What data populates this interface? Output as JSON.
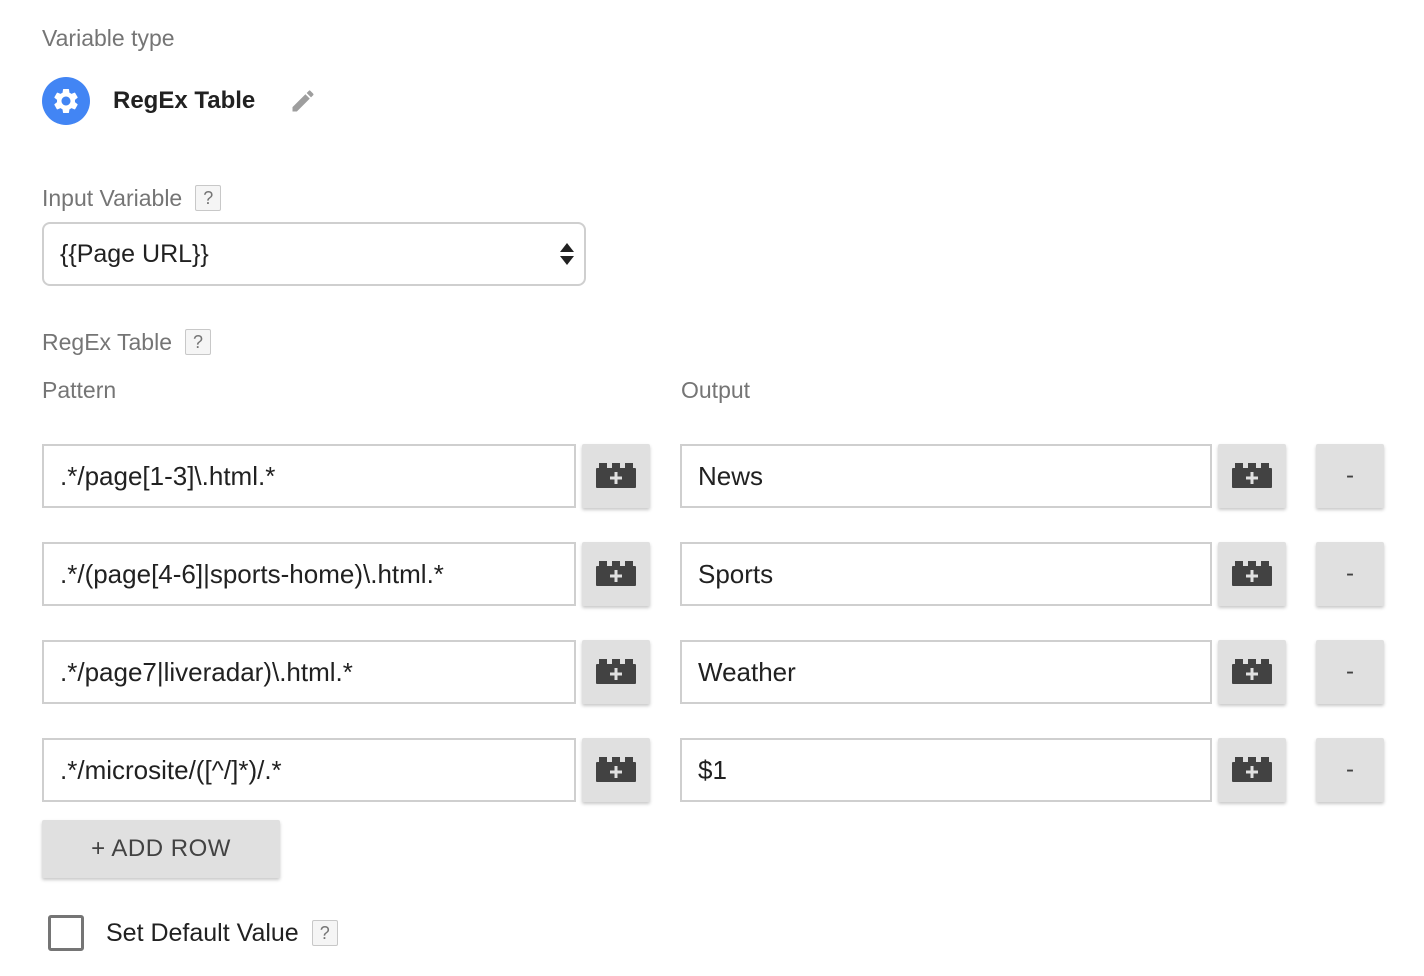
{
  "variable_type": {
    "label": "Variable type",
    "name": "RegEx Table",
    "icon": "gear-icon",
    "edit_icon": "pencil-icon",
    "accent_color": "#4285f4"
  },
  "input_variable": {
    "label": "Input Variable",
    "help": "?",
    "selected": "{{Page URL}}"
  },
  "regex_table": {
    "label": "RegEx Table",
    "help": "?",
    "pattern_header": "Pattern",
    "output_header": "Output",
    "rows": [
      {
        "pattern": ".*/page[1-3]\\.html.*",
        "output": "News",
        "remove_label": "-"
      },
      {
        "pattern": ".*/(page[4-6]|sports-home)\\.html.*",
        "output": "Sports",
        "remove_label": "-"
      },
      {
        "pattern": ".*/page7|liveradar)\\.html.*",
        "output": "Weather",
        "remove_label": "-"
      },
      {
        "pattern": ".*/microsite/([^/]*)/.*",
        "output": "$1",
        "remove_label": "-"
      }
    ],
    "add_row_label": "+ ADD ROW"
  },
  "default_value": {
    "label": "Set Default Value",
    "help": "?",
    "checked": false
  }
}
